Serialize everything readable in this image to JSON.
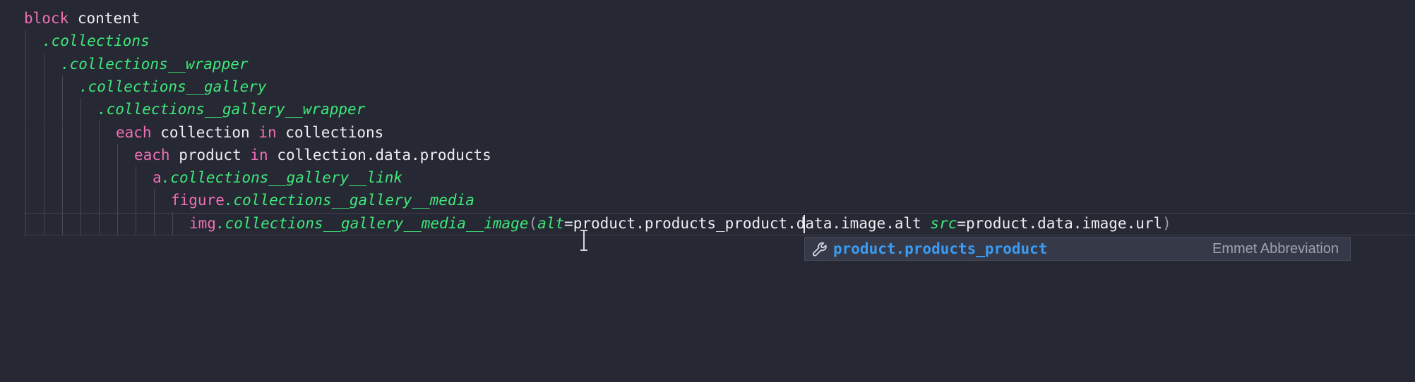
{
  "lines": [
    {
      "indent": 0,
      "tokens": [
        {
          "t": "block",
          "c": "kw"
        },
        {
          "t": " content",
          "c": "plain"
        }
      ]
    },
    {
      "indent": 1,
      "tokens": [
        {
          "t": ".collections",
          "c": "cls"
        }
      ]
    },
    {
      "indent": 2,
      "tokens": [
        {
          "t": ".collections__wrapper",
          "c": "cls"
        }
      ]
    },
    {
      "indent": 3,
      "tokens": [
        {
          "t": ".collections__gallery",
          "c": "cls"
        }
      ]
    },
    {
      "indent": 4,
      "tokens": [
        {
          "t": ".collections__gallery__wrapper",
          "c": "cls"
        }
      ]
    },
    {
      "indent": 5,
      "tokens": [
        {
          "t": "each",
          "c": "kw"
        },
        {
          "t": " collection ",
          "c": "plain"
        },
        {
          "t": "in",
          "c": "kw"
        },
        {
          "t": " collections",
          "c": "plain"
        }
      ]
    },
    {
      "indent": 6,
      "tokens": [
        {
          "t": "each",
          "c": "kw"
        },
        {
          "t": " product ",
          "c": "plain"
        },
        {
          "t": "in",
          "c": "kw"
        },
        {
          "t": " collection.data.products",
          "c": "plain"
        }
      ]
    },
    {
      "indent": 7,
      "tokens": [
        {
          "t": "a",
          "c": "kw"
        },
        {
          "t": ".collections__gallery__link",
          "c": "cls"
        }
      ]
    },
    {
      "indent": 8,
      "tokens": [
        {
          "t": "figure",
          "c": "kw"
        },
        {
          "t": ".collections__gallery__media",
          "c": "cls"
        }
      ]
    },
    {
      "indent": 9,
      "tokens": [
        {
          "t": "img",
          "c": "kw"
        },
        {
          "t": ".collections__gallery__media__image",
          "c": "cls"
        },
        {
          "t": "(",
          "c": "paren"
        },
        {
          "t": "alt",
          "c": "attr"
        },
        {
          "t": "=product.products_product",
          "c": "plain"
        },
        {
          "t": ".data.image.alt ",
          "c": "plain"
        },
        {
          "t": "src",
          "c": "attr"
        },
        {
          "t": "=product.data.image.url",
          "c": "plain"
        },
        {
          "t": ")",
          "c": "paren"
        }
      ]
    }
  ],
  "autocomplete": {
    "icon": "wrench-icon",
    "suggestion": "product.products_product",
    "detail": "Emmet Abbreviation"
  },
  "colors": {
    "background": "#262833",
    "keyword": "#f070b4",
    "class": "#3ee87a",
    "text": "#eeeef2",
    "suggestion": "#3a9cf4"
  }
}
